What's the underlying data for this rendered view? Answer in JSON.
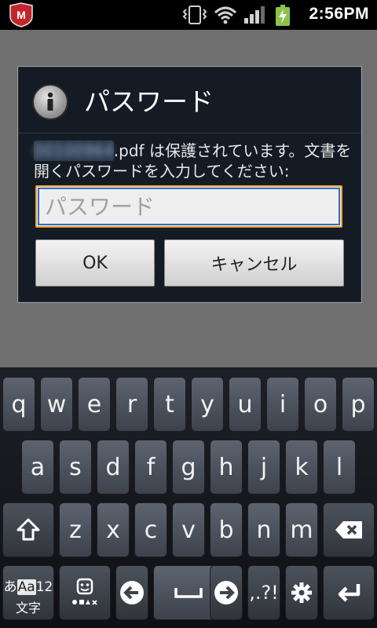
{
  "statusbar": {
    "time": "2:56PM",
    "icons": [
      "mcafee-icon",
      "vibrate-icon",
      "wifi-icon",
      "signal-icon",
      "battery-charging-icon"
    ]
  },
  "dialog": {
    "title": "パスワード",
    "icon": "info-icon",
    "message_filename": "00100964",
    "message_line1_rest": ".pdf は保護されています。文書を",
    "message_line2": "開くパスワードを入力してください:",
    "input": {
      "placeholder": "パスワード",
      "value": ""
    },
    "ok_label": "OK",
    "cancel_label": "キャンセル"
  },
  "keyboard": {
    "row1": [
      "q",
      "w",
      "e",
      "r",
      "t",
      "y",
      "u",
      "i",
      "o",
      "p"
    ],
    "row2": [
      "a",
      "s",
      "d",
      "f",
      "g",
      "h",
      "j",
      "k",
      "l"
    ],
    "row3": [
      "z",
      "x",
      "c",
      "v",
      "b",
      "n",
      "m"
    ],
    "mode_key": {
      "top": "あ",
      "mid": "Aa",
      "num": "12",
      "bottom": "文字"
    },
    "symbols_key": ",.?!",
    "icons": [
      "shift-icon",
      "backspace-icon",
      "emoji-icon",
      "left-arrow-icon",
      "space-icon",
      "right-arrow-icon",
      "settings-icon",
      "enter-icon"
    ]
  }
}
